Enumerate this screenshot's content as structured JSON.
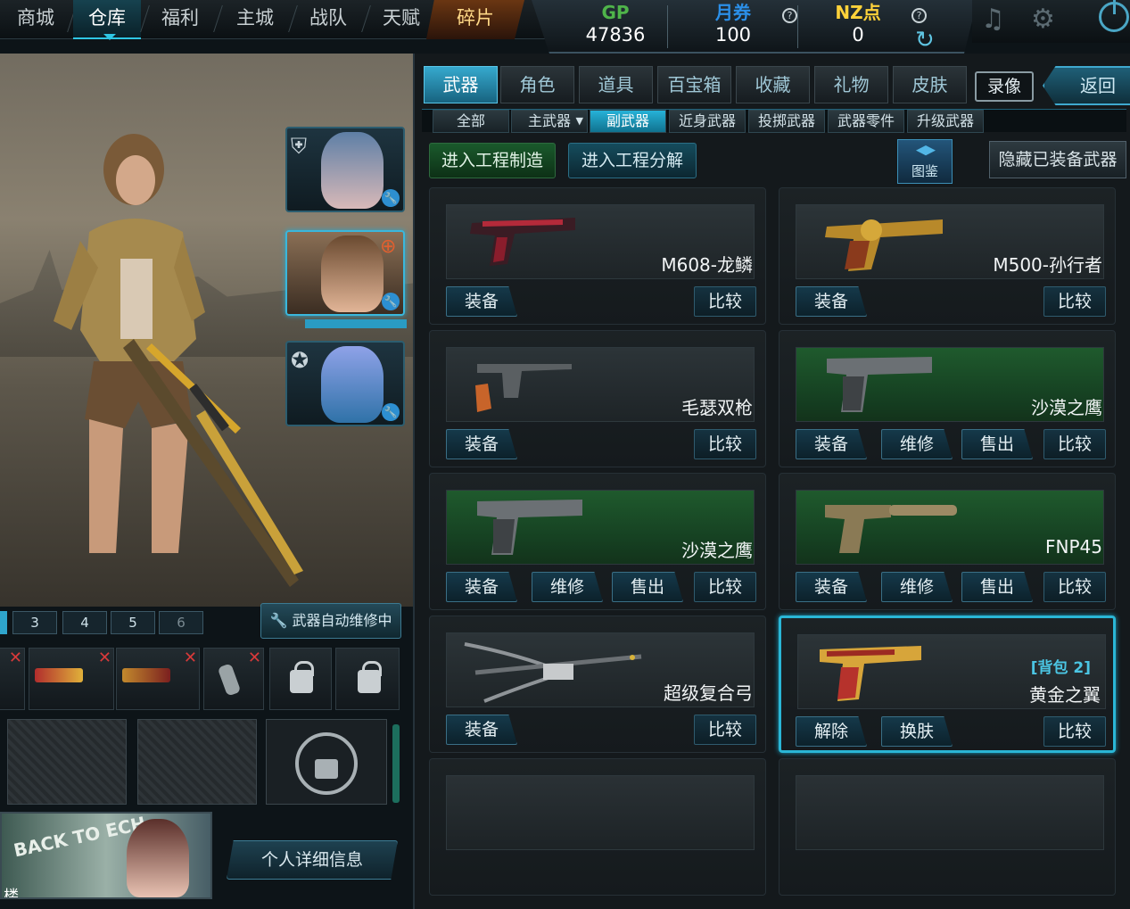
{
  "nav": {
    "items": [
      "商城",
      "仓库",
      "福利",
      "主城",
      "战队",
      "天赋",
      "碎片"
    ],
    "active": "仓库"
  },
  "currency": {
    "gp_label": "GP",
    "gp_value": "47836",
    "voucher_label": "月券",
    "voucher_value": "100",
    "nz_label": "NZ点",
    "nz_value": "0",
    "help": "?"
  },
  "colors": {
    "accent": "#2fc6e4",
    "gp": "#4fb44a",
    "voucher": "#2b8fe8",
    "nz": "#ffd23a",
    "remove_x": "#d83a3a"
  },
  "character": {
    "slot_numbers": [
      "3",
      "4",
      "5",
      "6"
    ],
    "auto_repair": "武器自动维修中",
    "detail_button": "个人详细信息",
    "banner_text": "楼",
    "banner_art_text": "BACK TO ECH"
  },
  "tabs": {
    "items": [
      "武器",
      "角色",
      "道具",
      "百宝箱",
      "收藏",
      "礼物",
      "皮肤"
    ],
    "active": "武器",
    "replay": "录像",
    "back": "返回"
  },
  "subtabs": {
    "items": [
      "全部",
      "主武器",
      "副武器",
      "近身武器",
      "投掷武器",
      "武器零件",
      "升级武器"
    ],
    "active": "副武器"
  },
  "actions": {
    "craft": "进入工程制造",
    "disassemble": "进入工程分解",
    "atlas": "图鉴",
    "hide_equipped": "隐藏已装备武器"
  },
  "weapons": [
    {
      "name": "M608-龙鳞",
      "buttons": [
        "装备"
      ],
      "compare": "比较"
    },
    {
      "name": "M500-孙行者",
      "buttons": [
        "装备"
      ],
      "compare": "比较"
    },
    {
      "name": "毛瑟双枪",
      "buttons": [
        "装备"
      ],
      "compare": "比较"
    },
    {
      "name": "沙漠之鹰",
      "buttons": [
        "装备",
        "维修",
        "售出"
      ],
      "compare": "比较"
    },
    {
      "name": "沙漠之鹰",
      "buttons": [
        "装备",
        "维修",
        "售出"
      ],
      "compare": "比较"
    },
    {
      "name": "FNP45",
      "buttons": [
        "装备",
        "维修",
        "售出"
      ],
      "compare": "比较"
    },
    {
      "name": "超级复合弓",
      "buttons": [
        "装备"
      ],
      "compare": "比较"
    },
    {
      "name": "黄金之翼",
      "bag": "[背包 2]",
      "buttons": [
        "解除",
        "换肤"
      ],
      "compare": "比较"
    }
  ]
}
